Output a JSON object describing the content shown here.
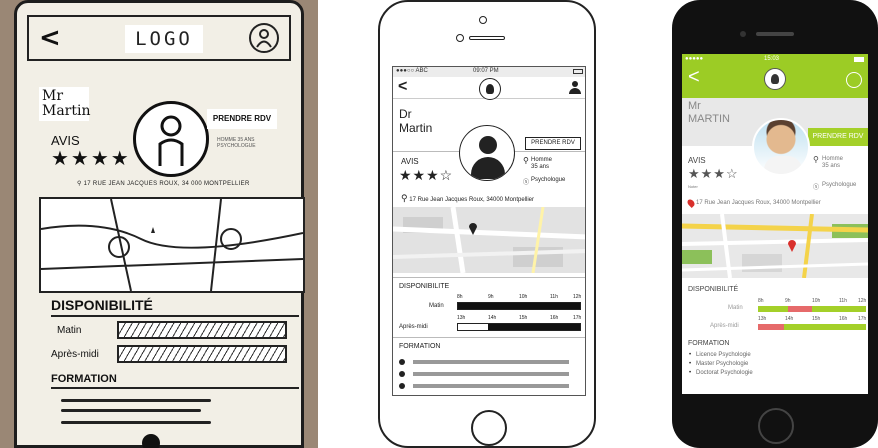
{
  "sketch": {
    "logo": "LOGO",
    "name": "Mr\nMartin",
    "prendre_rdv": "PRENDRE RDV",
    "avis": "AVIS",
    "stars": "★★★★",
    "info": "HOMME  35 ANS  PSYCHOLOGUE",
    "address": "17 RUE JEAN JACQUES ROUX, 34 000 MONTPELLIER",
    "disponibilite": "DISPONIBILITÉ",
    "matin": "Matin",
    "apres_midi": "Après-midi",
    "formation": "FORMATION"
  },
  "wire": {
    "status_carrier": "●●●○○ ABC",
    "status_time": "09:07 PM",
    "name": "Dr\nMartin",
    "prendre_rdv": "PRENDRE RDV",
    "avis": "AVIS",
    "stars": "★★★☆",
    "gender": "Homme\n35 ans",
    "specialty": "Psychologue",
    "address": "17 Rue Jean Jacques Roux, 34000 Montpellier",
    "disponibilite": "DISPONIBILITE",
    "matin": "Matin",
    "apres_midi": "Après-midi",
    "morning_hours": [
      "8h",
      "9h",
      "10h",
      "11h",
      "12h"
    ],
    "afternoon_hours": [
      "13h",
      "14h",
      "15h",
      "16h",
      "17h"
    ],
    "formation": "FORMATION"
  },
  "hifi": {
    "status_carrier": "●●●●● ",
    "status_time": "15:03",
    "name": "Mr\nMARTIN",
    "prendre_rdv": "PRENDRE RDV",
    "avis": "AVIS",
    "stars": "★★★☆",
    "noter": "Noter",
    "gender": "Homme\n35 ans",
    "specialty": "Psychologue",
    "address": "17 Rue Jean Jacques Roux, 34000 Montpellier",
    "disponibilite": "DISPONIBILITÉ",
    "matin": "Matin",
    "apres_midi": "Après-midi",
    "morning_hours": [
      "8h",
      "9h",
      "10h",
      "11h",
      "12h"
    ],
    "afternoon_hours": [
      "13h",
      "14h",
      "15h",
      "16h",
      "17h"
    ],
    "formation": "FORMATION",
    "formations": [
      "Licence Psychologie",
      "Master Psychologie",
      "Doctorat Psychologie"
    ],
    "colors": {
      "accent": "#9ccc25",
      "busy": "#e66a6a",
      "available": "#a4d029"
    }
  }
}
